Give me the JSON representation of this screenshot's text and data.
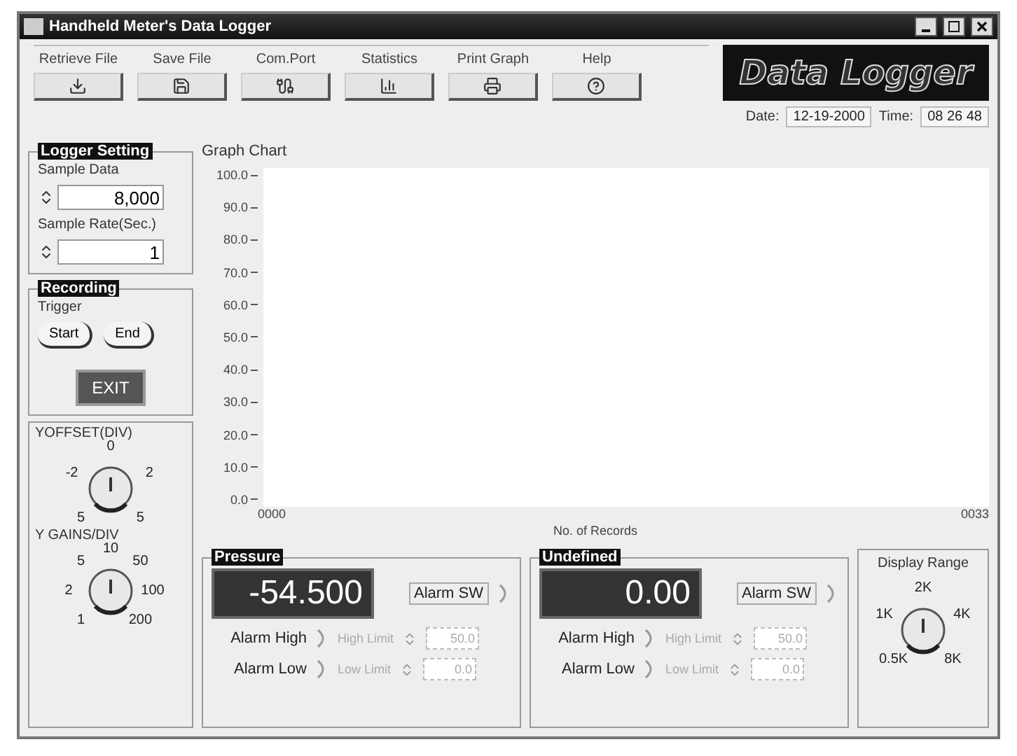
{
  "window": {
    "title": "Handheld Meter's Data Logger"
  },
  "toolbar": [
    {
      "label": "Retrieve File",
      "kind": "retrieve"
    },
    {
      "label": "Save File",
      "kind": "save"
    },
    {
      "label": "Com.Port",
      "kind": "port"
    },
    {
      "label": "Statistics",
      "kind": "stats"
    },
    {
      "label": "Print Graph",
      "kind": "print"
    },
    {
      "label": "Help",
      "kind": "help"
    }
  ],
  "logo": "Data Logger",
  "date": {
    "label": "Date:",
    "value": "12-19-2000"
  },
  "time": {
    "label": "Time:",
    "value": "08 26 48"
  },
  "logger_setting": {
    "title": "Logger Setting",
    "fields": [
      {
        "label": "Sample Data",
        "value": "8,000"
      },
      {
        "label": "Sample Rate(Sec.)",
        "value": "1"
      }
    ]
  },
  "recording": {
    "title": "Recording",
    "trigger_label": "Trigger",
    "buttons": [
      "Start",
      "End"
    ],
    "exit": "EXIT"
  },
  "graph": {
    "title": "Graph Chart",
    "y_labels": [
      "100.0",
      "90.0",
      "80.0",
      "70.0",
      "60.0",
      "50.0",
      "40.0",
      "30.0",
      "20.0",
      "10.0",
      "0.0"
    ],
    "x_start": "0000",
    "x_end": "0033",
    "x_label": "No. of Records"
  },
  "knobs": [
    {
      "title": "YOFFSET(DIV)",
      "labels": [
        "5",
        "-2",
        "0",
        "2",
        "5"
      ]
    },
    {
      "title": "Y GAINS/DIV",
      "labels": [
        "1",
        "2",
        "5",
        "10",
        "50",
        "100",
        "200"
      ]
    }
  ],
  "channels": [
    {
      "title": "Pressure",
      "reading": "-54.500",
      "switch_label": "Alarm SW",
      "alarms": [
        {
          "label": "Alarm High",
          "limit_label": "High Limit",
          "limit_value": "50.0",
          "disabled": true
        },
        {
          "label": "Alarm Low",
          "limit_label": "Low Limit",
          "limit_value": "0.0",
          "disabled": true
        }
      ]
    },
    {
      "title": "Undefined",
      "reading": "0.00",
      "switch_label": "Alarm SW",
      "alarms": [
        {
          "label": "Alarm High",
          "limit_label": "High Limit",
          "limit_value": "50.0",
          "disabled": true
        },
        {
          "label": "Alarm Low",
          "limit_label": "Low Limit",
          "limit_value": "0.0",
          "disabled": true
        }
      ]
    }
  ],
  "display_range": {
    "title": "Display Range",
    "labels": [
      "0.5K",
      "1K",
      "2K",
      "4K",
      "8K"
    ]
  }
}
